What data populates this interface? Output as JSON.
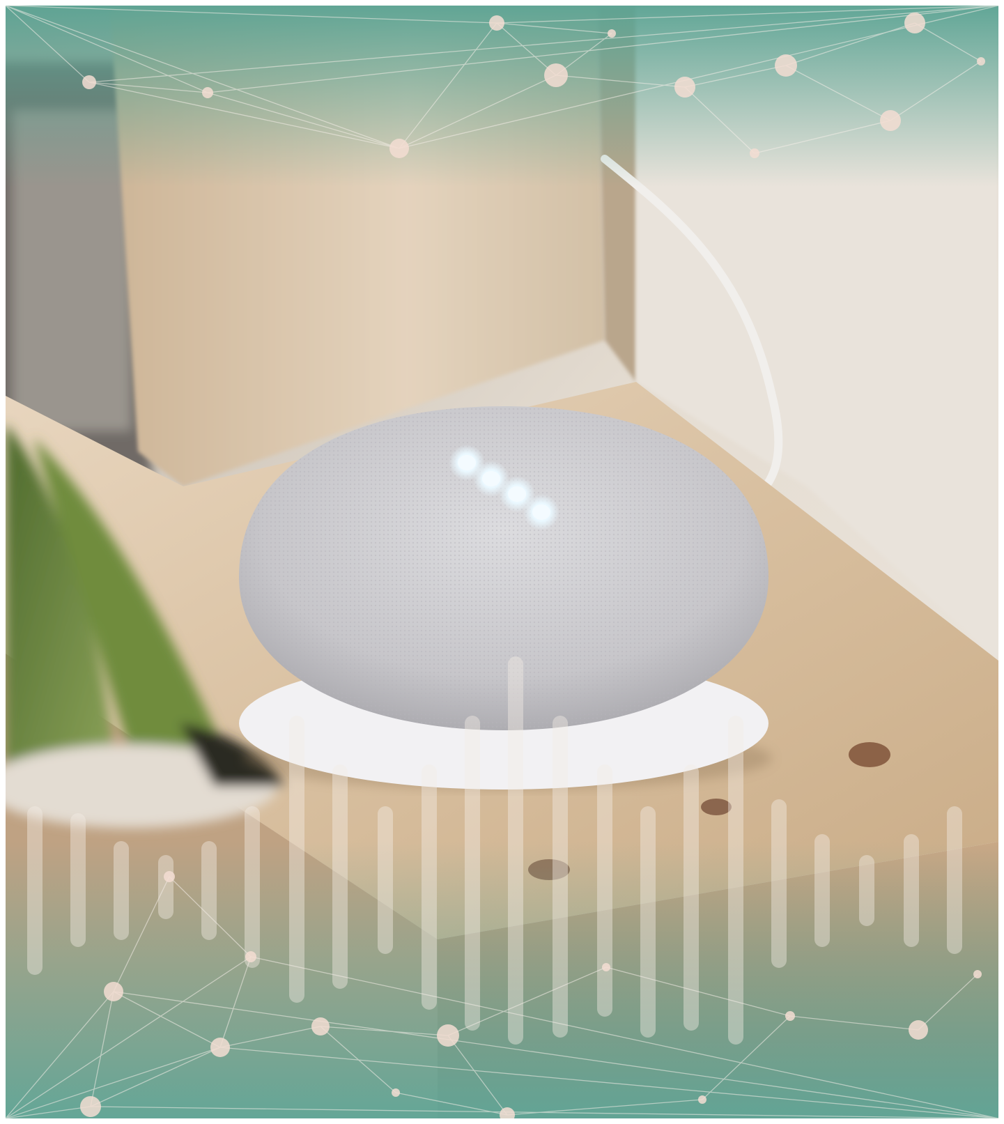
{
  "image": {
    "subject": "smart-speaker-on-wooden-shelf",
    "overlay": "network-constellation-and-sound-wave-bars",
    "colors": {
      "teal": "#5fa396",
      "wall": "#e8e0d6",
      "wood": "#d9c2a3",
      "speaker": "#cfcfd2",
      "led": "#f4fbff",
      "node": "#f3ddd2"
    },
    "speaker_led_count": 4
  }
}
